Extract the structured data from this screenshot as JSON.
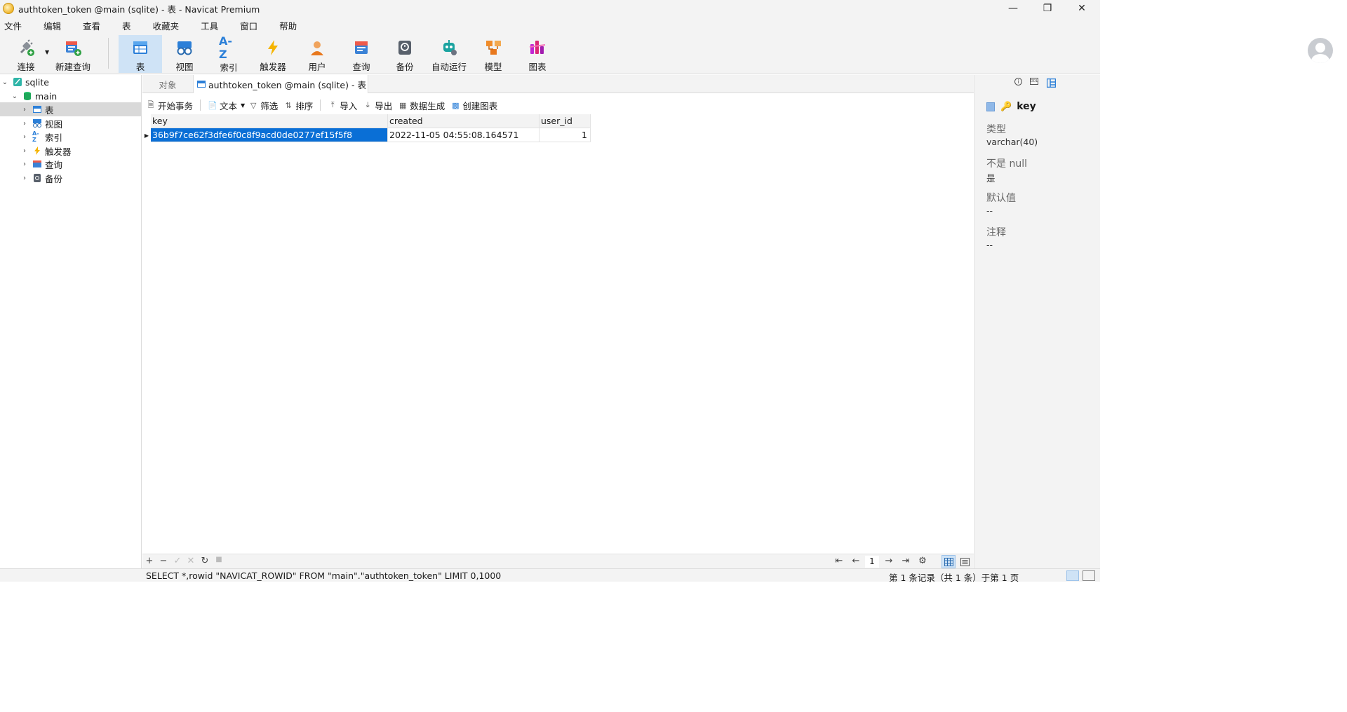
{
  "window": {
    "title": "authtoken_token @main (sqlite) - 表 - Navicat Premium",
    "controls": [
      "minimize-icon",
      "restore-icon",
      "close-icon"
    ]
  },
  "menu": [
    "文件",
    "编辑",
    "查看",
    "表",
    "收藏夹",
    "工具",
    "窗口",
    "帮助"
  ],
  "toolbar": {
    "connect": "连接",
    "new_query": "新建查询",
    "table": "表",
    "view": "视图",
    "index": "索引",
    "trigger": "触发器",
    "user": "用户",
    "query": "查询",
    "backup": "备份",
    "automation": "自动运行",
    "model": "模型",
    "chart": "图表",
    "index_icon_text": "A-Z"
  },
  "tree": {
    "connection": "sqlite",
    "database": "main",
    "items": [
      "表",
      "视图",
      "索引",
      "触发器",
      "查询",
      "备份"
    ],
    "selected": "表"
  },
  "tabs": {
    "objects": "对象",
    "active": "authtoken_token @main (sqlite) - 表"
  },
  "subtoolbar": {
    "begin_transaction": "开始事务",
    "text": "文本",
    "filter": "筛选",
    "sort": "排序",
    "import": "导入",
    "export": "导出",
    "data_generation": "数据生成",
    "create_chart": "创建图表"
  },
  "grid": {
    "columns": [
      "key",
      "created",
      "user_id"
    ],
    "rows": [
      [
        "36b9f7ce62f3dfe6f0c8f9acd0de0277ef15f5f8",
        "2022-11-05 04:55:08.164571",
        "1"
      ]
    ]
  },
  "pagination": {
    "page": "1"
  },
  "right_panel": {
    "field_name": "key",
    "type_label": "类型",
    "type_value": "varchar(40)",
    "not_null_label": "不是 null",
    "not_null_value": "是",
    "default_label": "默认值",
    "default_value": "--",
    "comment_label": "注释",
    "comment_value": "--"
  },
  "status": {
    "sql": "SELECT *,rowid \"NAVICAT_ROWID\" FROM \"main\".\"authtoken_token\" LIMIT 0,1000",
    "records": "第 1 条记录（共 1 条）于第 1 页"
  },
  "colors": {
    "accent": "#0a6fd6",
    "active_tool": "#cfe3f6"
  }
}
